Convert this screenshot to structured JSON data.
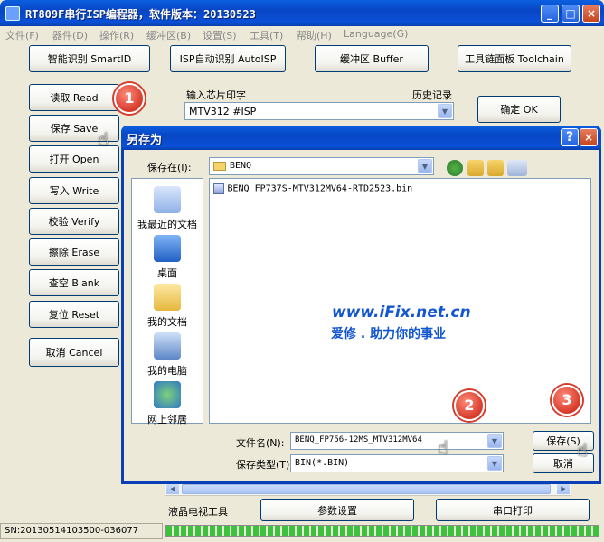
{
  "main_window": {
    "title": "RT809F串行ISP编程器，软件版本：20130523",
    "title_buttons": [
      "_",
      "□",
      "×"
    ]
  },
  "menu": [
    "文件(F)",
    "器件(D)",
    "操作(R)",
    "缓冲区(B)",
    "设置(S)",
    "工具(T)",
    "帮助(H)",
    "Language(G)"
  ],
  "top_buttons": {
    "smart_id": "智能识别 SmartID",
    "isp_auto": "ISP自动识别 AutoISP",
    "buffer": "缓冲区 Buffer",
    "toolchain": "工具链面板 Toolchain"
  },
  "left_buttons": [
    "读取 Read",
    "保存 Save",
    "打开 Open",
    "写入 Write",
    "校验 Verify",
    "擦除 Erase",
    "查空 Blank",
    "复位 Reset",
    "取消 Cancel"
  ],
  "chip": {
    "label": "输入芯片印字",
    "history_label": "历史记录",
    "value": "MTV312 #ISP",
    "ok_button": "确定 OK"
  },
  "bottom": {
    "lcd_tool": "液晶电视工具",
    "params": "参数设置",
    "serial_print": "串口打印",
    "status_sn": "SN:20130514103500-036077"
  },
  "dialog": {
    "title": "另存为",
    "save_in_label": "保存在(I):",
    "save_in_value": "BENQ",
    "places": [
      "我最近的文档",
      "桌面",
      "我的文档",
      "我的电脑",
      "网上邻居"
    ],
    "files": [
      "BENQ FP737S-MTV312MV64-RTD2523.bin"
    ],
    "filename_label": "文件名(N):",
    "filename_value": "BENQ_FP756-12MS_MTV312MV64",
    "filetype_label": "保存类型(T):",
    "filetype_value": "BIN(*.BIN)",
    "save_button": "保存(S)",
    "cancel_button": "取消",
    "help_button": "?",
    "close_button": "×"
  },
  "watermark": {
    "line1": "www.iFix.net.cn",
    "line2": "爱修 . 助力你的事业"
  },
  "callouts": [
    "1",
    "2",
    "3"
  ]
}
